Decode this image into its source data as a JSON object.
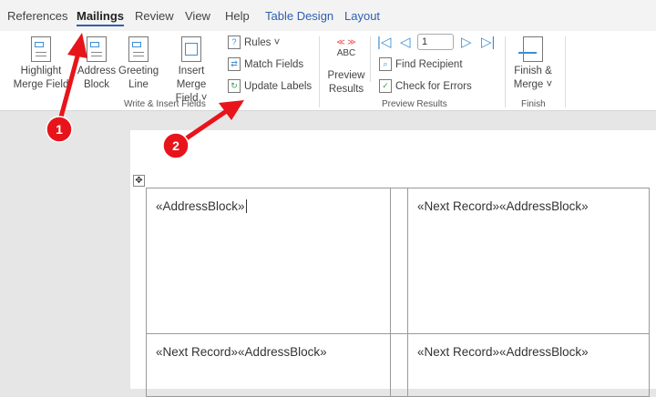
{
  "tabs": [
    "References",
    "Mailings",
    "Review",
    "View",
    "Help",
    "Table Design",
    "Layout"
  ],
  "ribbon": {
    "write_insert": {
      "highlight": [
        "Highlight",
        "Merge Field"
      ],
      "address": [
        "Address",
        "Block"
      ],
      "greeting": [
        "Greeting",
        "Line"
      ],
      "insert_merge": [
        "Insert Merge",
        "Field ˅"
      ],
      "rules": "Rules ˅",
      "match": "Match Fields",
      "update": "Update Labels",
      "group_label": "Write & Insert Fields"
    },
    "preview": {
      "abc": "ABC",
      "label": [
        "Preview",
        "Results"
      ],
      "record": "1",
      "find": "Find Recipient",
      "check": "Check for Errors",
      "group_label": "Preview Results"
    },
    "finish": {
      "label": [
        "Finish &",
        "Merge ˅"
      ],
      "group_label": "Finish"
    }
  },
  "document": {
    "cells": [
      "«AddressBlock»",
      "«Next Record»«AddressBlock»",
      "«Next Record»«AddressBlock»",
      "«Next Record»«AddressBlock»"
    ]
  },
  "annotations": [
    "1",
    "2"
  ],
  "colors": {
    "accent": "#2f5fb0",
    "arrow": "#e8141b"
  }
}
